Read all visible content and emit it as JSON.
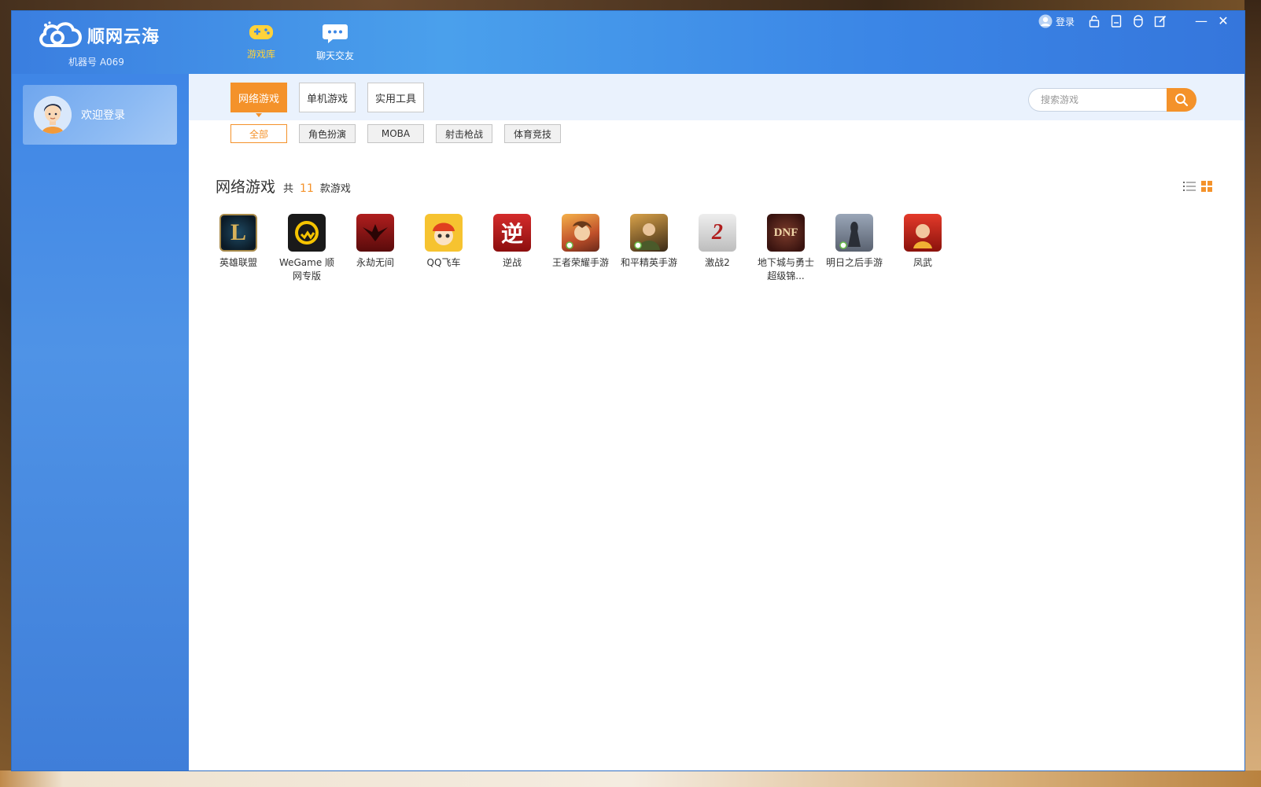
{
  "app": {
    "logo_text": "顺网云海",
    "machine_id": "机器号 A069"
  },
  "top_nav": [
    {
      "label": "游戏库",
      "icon": "gamepad-icon",
      "active": true
    },
    {
      "label": "聊天交友",
      "icon": "chat-bubble-icon",
      "active": false
    }
  ],
  "top_right": {
    "login_label": "登录",
    "icons": [
      "lock-icon",
      "document-icon",
      "mouse-icon",
      "edit-icon"
    ],
    "minimize": "—",
    "close": "✕"
  },
  "sidebar": {
    "welcome": "欢迎登录"
  },
  "main_tabs": [
    {
      "label": "网络游戏",
      "active": true
    },
    {
      "label": "单机游戏",
      "active": false
    },
    {
      "label": "实用工具",
      "active": false
    }
  ],
  "search": {
    "placeholder": "搜索游戏"
  },
  "sub_tabs": [
    {
      "label": "全部",
      "active": true
    },
    {
      "label": "角色扮演",
      "active": false
    },
    {
      "label": "MOBA",
      "active": false
    },
    {
      "label": "射击枪战",
      "active": false
    },
    {
      "label": "体育竞技",
      "active": false
    }
  ],
  "section": {
    "title": "网络游戏",
    "count_prefix": "共",
    "count": "11",
    "count_suffix": "款游戏"
  },
  "games": [
    {
      "name": "英雄联盟",
      "icon": "league-of-legends-icon"
    },
    {
      "name": "WeGame 顺网专版",
      "icon": "wegame-icon"
    },
    {
      "name": "永劫无间",
      "icon": "naraka-icon"
    },
    {
      "name": "QQ飞车",
      "icon": "qq-speed-icon"
    },
    {
      "name": "逆战",
      "icon": "nizhan-icon"
    },
    {
      "name": "王者荣耀手游",
      "icon": "honor-of-kings-icon"
    },
    {
      "name": "和平精英手游",
      "icon": "peacekeeper-elite-icon"
    },
    {
      "name": "激战2",
      "icon": "guild-wars-2-icon"
    },
    {
      "name": "地下城与勇士超级锦...",
      "icon": "dnf-icon"
    },
    {
      "name": "明日之后手游",
      "icon": "life-after-icon"
    },
    {
      "name": "凤武",
      "icon": "fengwu-icon"
    }
  ],
  "colors": {
    "accent": "#f4922a",
    "titlebar": "#3b86e6",
    "sidebar": "#4a8de4"
  }
}
